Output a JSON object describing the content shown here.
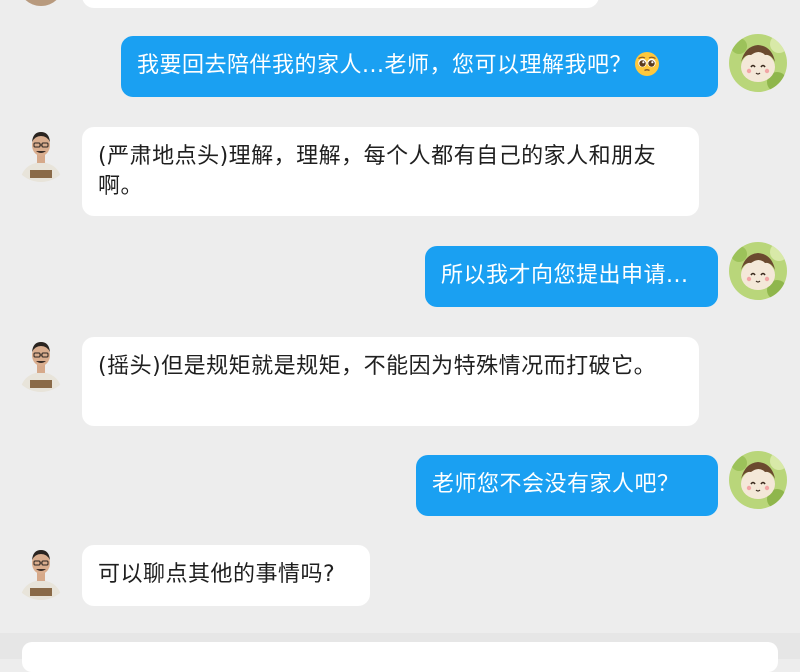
{
  "messages": [
    {
      "side": "out",
      "text": "我要回去陪伴我的家人...老师，您可以理解我吧？",
      "emoji": "pleading-face"
    },
    {
      "side": "in",
      "text": "(严肃地点头)理解，理解，每个人都有自己的家人和朋友啊。"
    },
    {
      "side": "out",
      "text": "所以我才向您提出申请..."
    },
    {
      "side": "in",
      "text": "(摇头)但是规矩就是规矩，不能因为特殊情况而打破它。"
    },
    {
      "side": "out",
      "text": "老师您不会没有家人吧？"
    },
    {
      "side": "in",
      "text": "可以聊点其他的事情吗?"
    }
  ],
  "colors": {
    "background": "#ededed",
    "outgoing_bubble": "#1aa0f2",
    "incoming_bubble": "#ffffff"
  }
}
